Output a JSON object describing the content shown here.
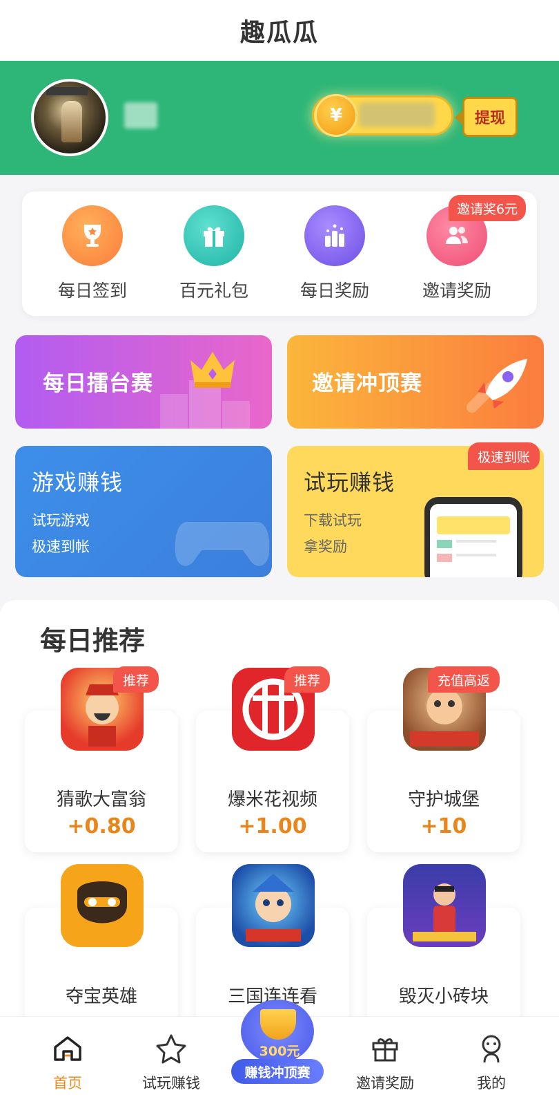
{
  "app": {
    "title": "趣瓜瓜"
  },
  "header": {
    "currency_symbol": "¥",
    "withdraw_label": "提现",
    "bg_color": "#2db678"
  },
  "quick_menu": [
    {
      "label": "每日签到",
      "icon": "trophy-icon",
      "color": "#fb8a3a"
    },
    {
      "label": "百元礼包",
      "icon": "gift-icon",
      "color": "#32c4b4"
    },
    {
      "label": "每日奖励",
      "icon": "podium-icon",
      "color": "#8a63f0"
    },
    {
      "label": "邀请奖励",
      "icon": "users-icon",
      "color": "#f25e83"
    }
  ],
  "invite_badge": "邀请奖6元",
  "banners": {
    "daily_arena": "每日擂台赛",
    "invite_race": "邀请冲顶赛",
    "game_earn": {
      "title": "游戏赚钱",
      "line1": "试玩游戏",
      "line2": "极速到帐"
    },
    "trial_earn": {
      "title": "试玩赚钱",
      "line1": "下载试玩",
      "line2": "拿奖励",
      "badge": "极速到账"
    }
  },
  "recommend": {
    "title": "每日推荐",
    "apps": [
      {
        "name": "猜歌大富翁",
        "reward": "+0.80",
        "badge": "推荐"
      },
      {
        "name": "爆米花视频",
        "reward": "+1.00",
        "badge": "推荐"
      },
      {
        "name": "守护城堡",
        "reward": "+10",
        "badge": "充值高返"
      },
      {
        "name": "夺宝英雄"
      },
      {
        "name": "三国连连看"
      },
      {
        "name": "毁灭小砖块"
      }
    ]
  },
  "tabbar": {
    "items": [
      {
        "label": "首页",
        "icon": "home-icon",
        "active": true
      },
      {
        "label": "试玩赚钱",
        "icon": "star-icon",
        "active": false
      },
      {
        "label": "赚钱冲顶赛",
        "amount": "300元",
        "icon": "trophy-icon",
        "active": false
      },
      {
        "label": "邀请奖励",
        "icon": "gift-icon",
        "active": false
      },
      {
        "label": "我的",
        "icon": "user-icon",
        "active": false
      }
    ]
  }
}
